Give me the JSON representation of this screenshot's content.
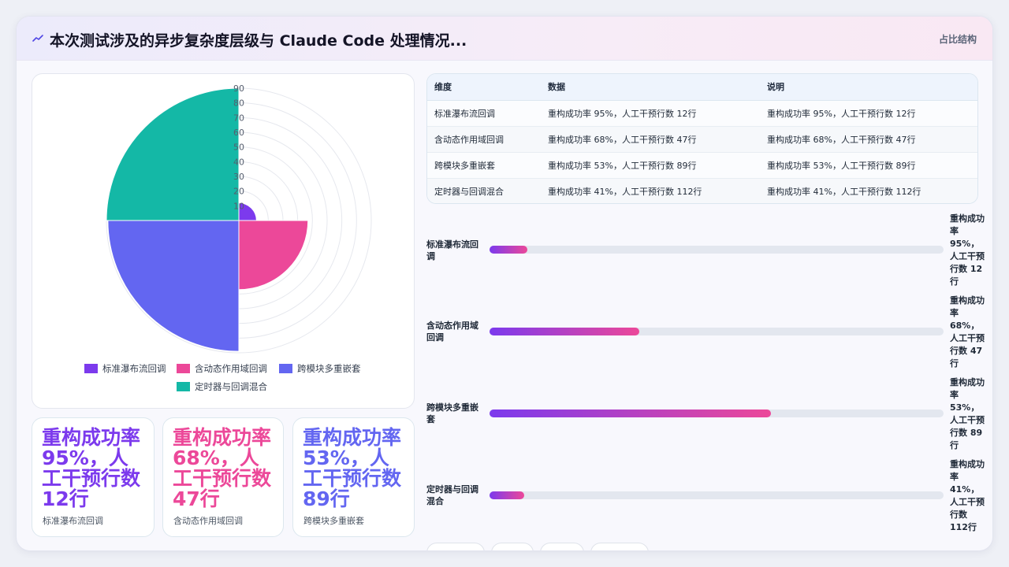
{
  "header": {
    "title": "本次测试涉及的异步复杂度层级与 Claude Code 处理情况...",
    "right_label": "占比结构"
  },
  "colors": {
    "purple": "#7c3aed",
    "pink": "#ec4899",
    "indigo": "#6366f1",
    "teal": "#14b8a6"
  },
  "chart_data": {
    "type": "polar-area",
    "categories": [
      "标准瀑布流回调",
      "含动态作用域回调",
      "跨模块多重嵌套",
      "定时器与回调混合"
    ],
    "values": [
      12,
      47,
      89,
      112
    ],
    "colors": [
      "#7c3aed",
      "#ec4899",
      "#6366f1",
      "#14b8a6"
    ],
    "r_ticks": [
      10,
      20,
      30,
      40,
      50,
      60,
      70,
      80,
      90
    ],
    "r_tick_labels": [
      "10",
      "20",
      "30",
      "40",
      "50",
      "60",
      "70",
      "80",
      "90"
    ],
    "legend_position": "bottom",
    "rmax": 90
  },
  "kpis": [
    {
      "value": "重构成功率 95%，人工干预行数 12行",
      "label": "标准瀑布流回调",
      "color": "#7c3aed"
    },
    {
      "value": "重构成功率 68%，人工干预行数 47行",
      "label": "含动态作用域回调",
      "color": "#ec4899"
    },
    {
      "value": "重构成功率 53%，人工干预行数 89行",
      "label": "跨模块多重嵌套",
      "color": "#6366f1"
    }
  ],
  "table": {
    "headers": [
      "维度",
      "数据",
      "说明"
    ],
    "rows": [
      [
        "标准瀑布流回调",
        "重构成功率 95%，人工干预行数 12行",
        "重构成功率 95%，人工干预行数 12行"
      ],
      [
        "含动态作用域回调",
        "重构成功率 68%，人工干预行数 47行",
        "重构成功率 68%，人工干预行数 47行"
      ],
      [
        "跨模块多重嵌套",
        "重构成功率 53%，人工干预行数 89行",
        "重构成功率 53%，人工干预行数 89行"
      ],
      [
        "定时器与回调混合",
        "重构成功率 41%，人工干预行数 112行",
        "重构成功率 41%，人工干预行数 112行"
      ]
    ]
  },
  "bars": [
    {
      "label": "标准瀑布流回调",
      "value": "重构成功率 95%，人工干预行数 12行",
      "fill": 0.083
    },
    {
      "label": "含动态作用域回调",
      "value": "重构成功率 68%，人工干预行数 47行",
      "fill": 0.33
    },
    {
      "label": "跨模块多重嵌套",
      "value": "重构成功率 53%，人工干预行数 89行",
      "fill": 0.62
    },
    {
      "label": "定时器与回调混合",
      "value": "重构成功率 41%，人工干预行数 112行",
      "fill": 0.076
    }
  ]
}
